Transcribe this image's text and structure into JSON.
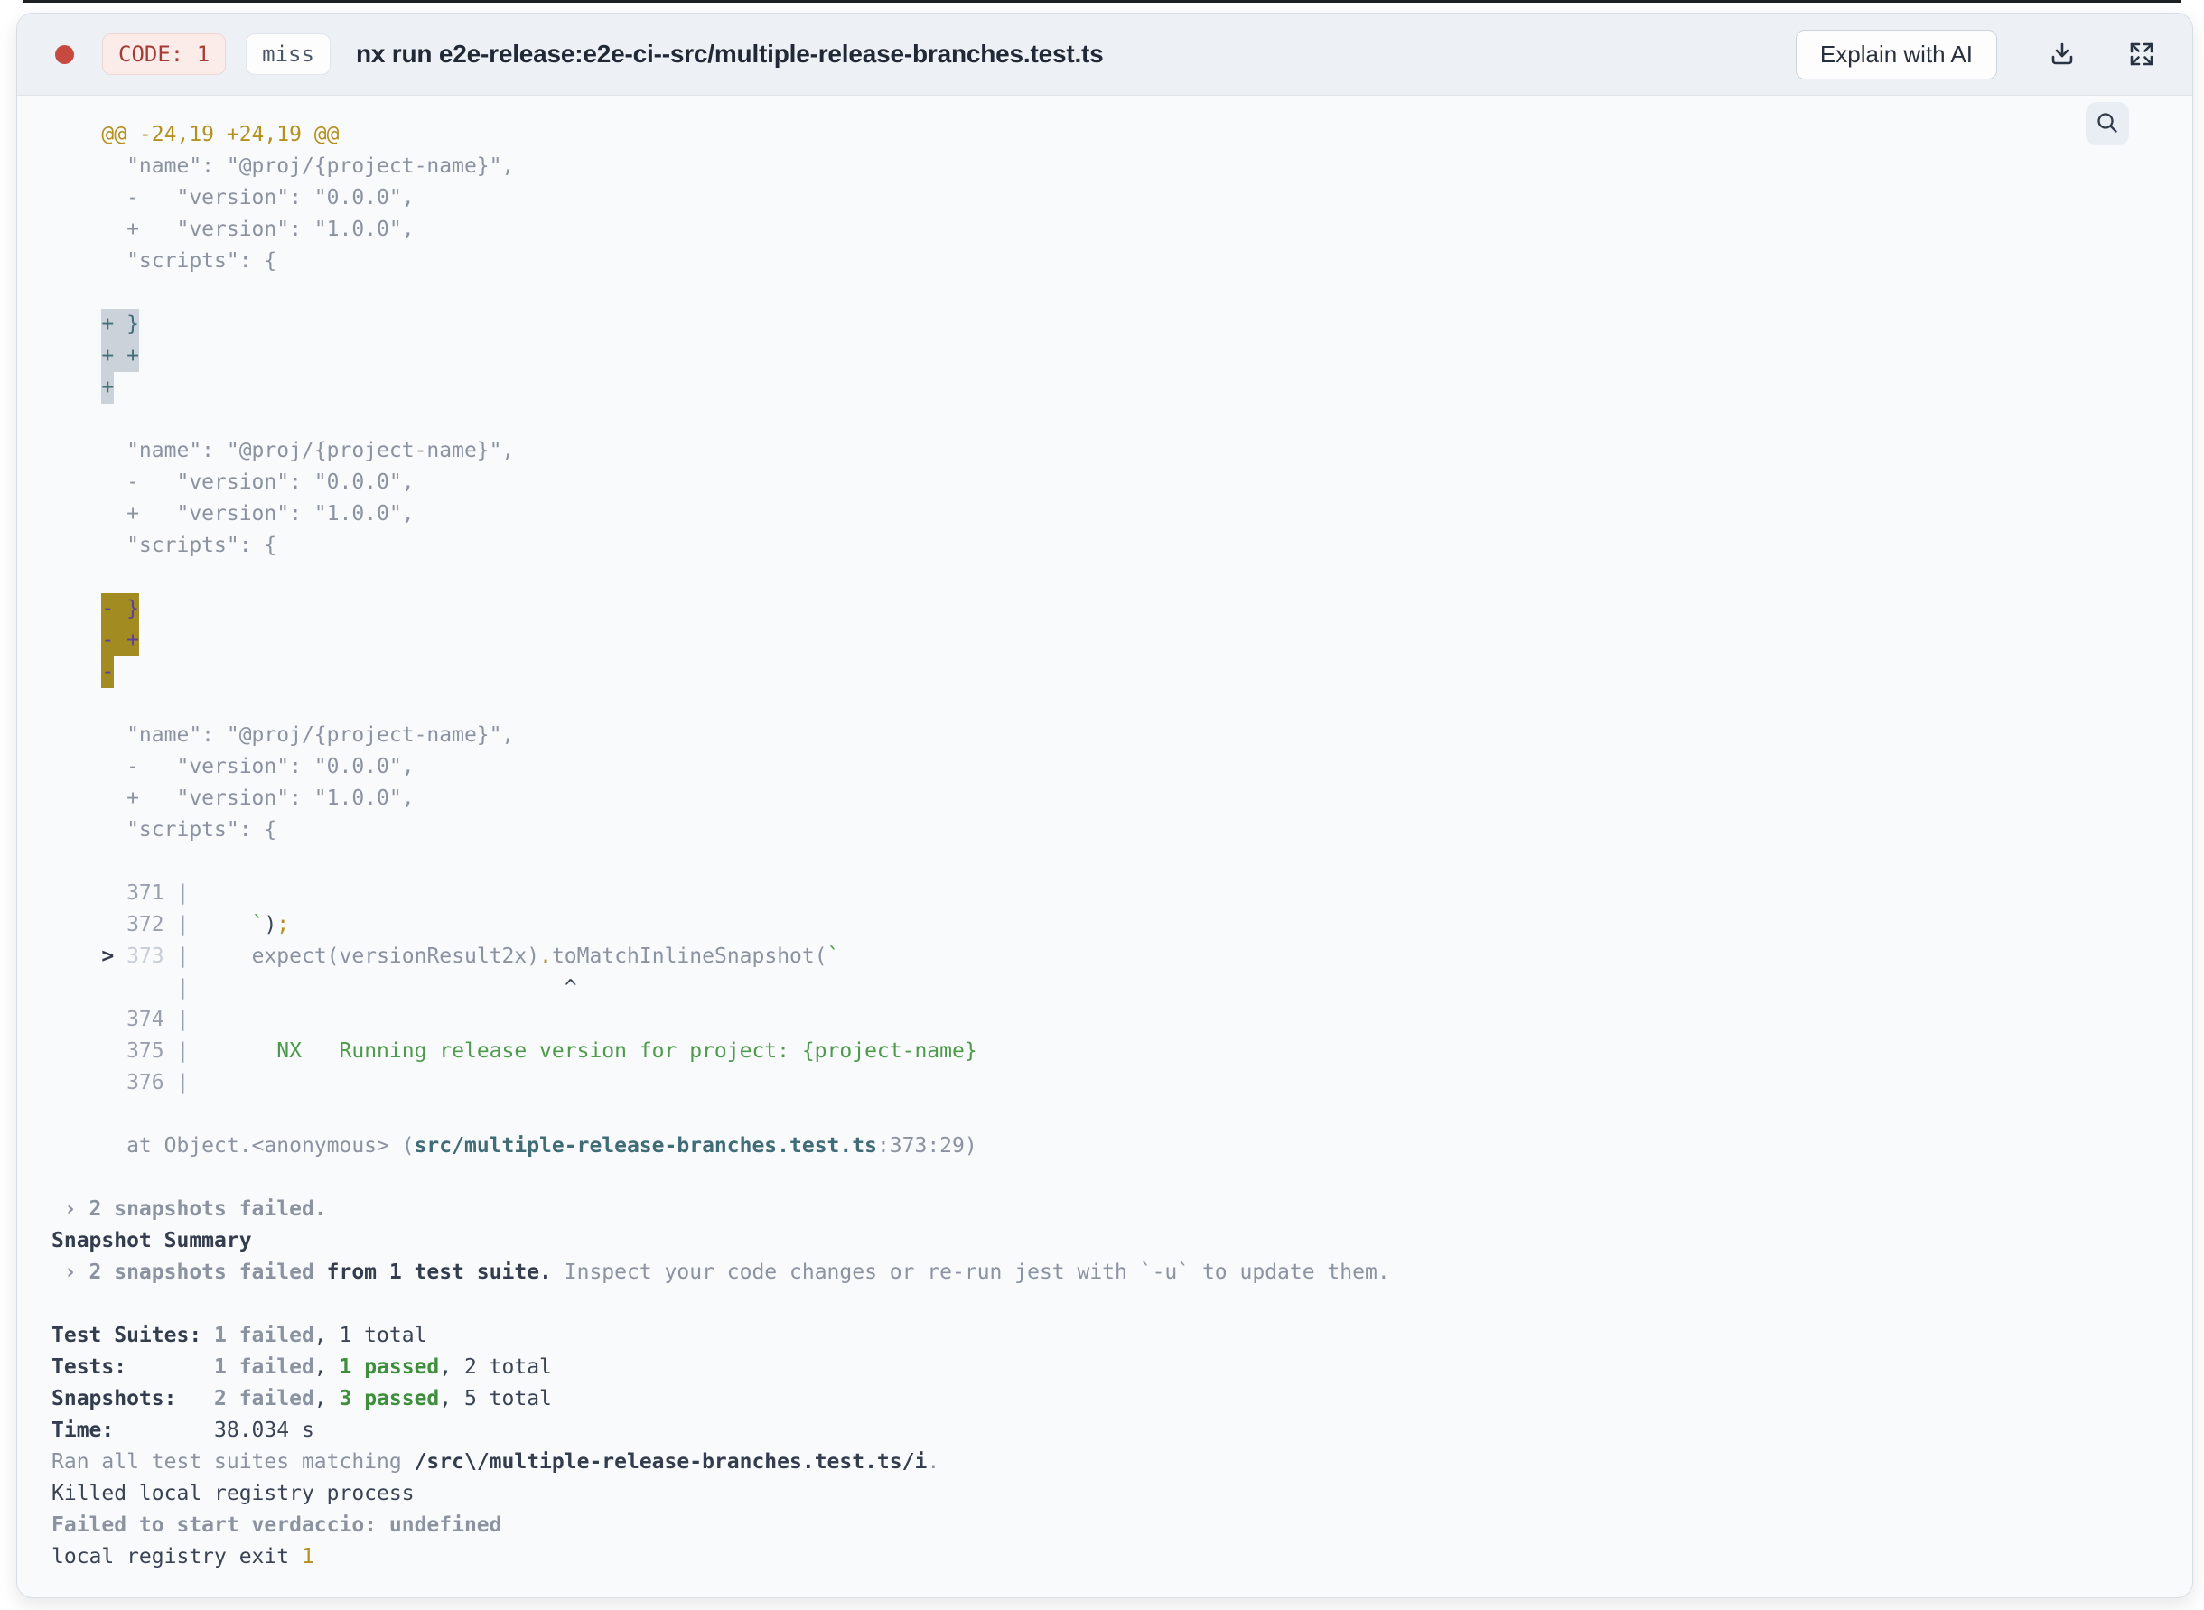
{
  "header": {
    "code_badge": "CODE: 1",
    "cache_badge": "miss",
    "title": "nx run e2e-release:e2e-ci--src/multiple-release-branches.test.ts",
    "explain_button": "Explain with AI",
    "status_dot_color": "#c64a40",
    "icons": {
      "download": "download-icon",
      "fullscreen": "fullscreen-icon",
      "search": "search-icon"
    }
  },
  "colors": {
    "header_bg": "#edf0f5",
    "terminal_bg": "#f8fafc",
    "gold": "#b5901f",
    "grey": "#8b93a1",
    "dark": "#343d4e",
    "green": "#3f8e3c",
    "teal": "#3f6c77",
    "added_highlight_bg": "#cbd2d9",
    "added_highlight_text": "#41707b",
    "removed_highlight_bg": "#a28c22",
    "removed_highlight_text": "#5c41a1",
    "error_badge_text": "#a63b35",
    "error_badge_bg": "#fbecea"
  },
  "terminal": {
    "lines": [
      [
        [
          "    @@ -24,19 +24,19 @@",
          "gold"
        ]
      ],
      [
        [
          "      \"name\": \"@proj/{project-name}\",",
          "grey"
        ]
      ],
      [
        [
          "      -   \"version\": \"0.0.0\",",
          "grey"
        ]
      ],
      [
        [
          "      +   \"version\": \"1.0.0\",",
          "grey"
        ]
      ],
      [
        [
          "      \"scripts\": {",
          "grey"
        ]
      ],
      [],
      [
        [
          "    ",
          "grey"
        ],
        [
          "+ }",
          "hlgrey"
        ]
      ],
      [
        [
          "    ",
          "grey"
        ],
        [
          "+ +",
          "hlgrey"
        ]
      ],
      [
        [
          "    ",
          "grey"
        ],
        [
          "+",
          "hlgrey"
        ]
      ],
      [],
      [
        [
          "      \"name\": \"@proj/{project-name}\",",
          "grey"
        ]
      ],
      [
        [
          "      -   \"version\": \"0.0.0\",",
          "grey"
        ]
      ],
      [
        [
          "      +   \"version\": \"1.0.0\",",
          "grey"
        ]
      ],
      [
        [
          "      \"scripts\": {",
          "grey"
        ]
      ],
      [],
      [
        [
          "    ",
          "grey"
        ],
        [
          "- }",
          "hlgold"
        ]
      ],
      [
        [
          "    ",
          "grey"
        ],
        [
          "- +",
          "hlgold"
        ]
      ],
      [
        [
          "    ",
          "grey"
        ],
        [
          "-",
          "hlgold"
        ]
      ],
      [],
      [
        [
          "      \"name\": \"@proj/{project-name}\",",
          "grey"
        ]
      ],
      [
        [
          "      -   \"version\": \"0.0.0\",",
          "grey"
        ]
      ],
      [
        [
          "      +   \"version\": \"1.0.0\",",
          "grey"
        ]
      ],
      [
        [
          "      \"scripts\": {",
          "grey"
        ]
      ],
      [],
      [
        [
          "      371 |",
          "num"
        ]
      ],
      [
        [
          "      372 |",
          "num"
        ],
        [
          "     ",
          "grey"
        ],
        [
          "`",
          "green"
        ],
        [
          ")",
          "dark"
        ],
        [
          ";",
          "gold"
        ]
      ],
      [
        [
          "    ",
          "grey"
        ],
        [
          ">",
          "darkb"
        ],
        [
          " ",
          "grey"
        ],
        [
          "373",
          "faded"
        ],
        [
          " |",
          "num"
        ],
        [
          "     expect(versionResult2x)",
          "grey"
        ],
        [
          ".",
          "gold"
        ],
        [
          "toMatchInlineSnapshot(",
          "grey"
        ],
        [
          "`",
          "green"
        ]
      ],
      [
        [
          "          |",
          "num"
        ],
        [
          "                              ^",
          "dark"
        ]
      ],
      [
        [
          "      374 |",
          "num"
        ]
      ],
      [
        [
          "      375 |",
          "num"
        ],
        [
          "       NX   Running release version for project: {project-name}",
          "green"
        ]
      ],
      [
        [
          "      376 |",
          "num"
        ]
      ],
      [],
      [
        [
          "      at Object.<anonymous> (",
          "grey"
        ],
        [
          "src/multiple-release-branches.test.ts",
          "tealb"
        ],
        [
          ":373:29)",
          "grey"
        ]
      ],
      [],
      [
        [
          " › 2 snapshots failed.",
          "greyb"
        ]
      ],
      [
        [
          "Snapshot Summary",
          "darkb"
        ]
      ],
      [
        [
          " › 2 snapshots failed",
          "greyb"
        ],
        [
          " from 1 test suite.",
          "darkb"
        ],
        [
          " Inspect your code changes or re-run jest with `-u` to update them.",
          "grey"
        ]
      ],
      [],
      [
        [
          "Test Suites: ",
          "darkb"
        ],
        [
          "1 failed",
          "greyb"
        ],
        [
          ", 1 total",
          "dark"
        ]
      ],
      [
        [
          "Tests:       ",
          "darkb"
        ],
        [
          "1 failed",
          "greyb"
        ],
        [
          ", ",
          "dark"
        ],
        [
          "1 passed",
          "greenb"
        ],
        [
          ", 2 total",
          "dark"
        ]
      ],
      [
        [
          "Snapshots:   ",
          "darkb"
        ],
        [
          "2 failed",
          "greyb"
        ],
        [
          ", ",
          "dark"
        ],
        [
          "3 passed",
          "greenb"
        ],
        [
          ", 5 total",
          "dark"
        ]
      ],
      [
        [
          "Time:        ",
          "darkb"
        ],
        [
          "38.034 s",
          "dark"
        ]
      ],
      [
        [
          "Ran all test suites matching ",
          "grey"
        ],
        [
          "/src\\/multiple-release-branches.test.ts/i",
          "darkb"
        ],
        [
          ".",
          "grey"
        ]
      ],
      [
        [
          "Killed local registry process",
          "dark"
        ]
      ],
      [
        [
          "Failed to start verdaccio: undefined",
          "greyb"
        ]
      ],
      [
        [
          "local registry exit ",
          "dark"
        ],
        [
          "1",
          "gold"
        ]
      ]
    ]
  }
}
